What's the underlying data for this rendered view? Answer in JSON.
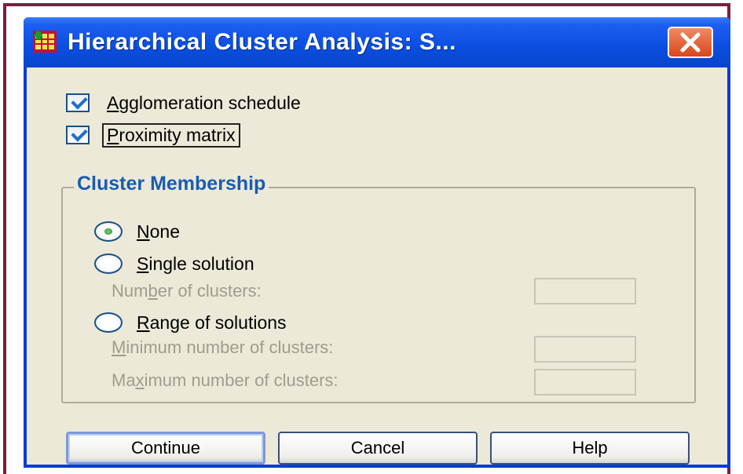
{
  "window": {
    "title": "Hierarchical Cluster Analysis: S...",
    "close_icon": "close-icon",
    "app_icon": "spss-table-icon"
  },
  "statistics": {
    "agglomeration": {
      "label": "Agglomeration schedule",
      "mnemonic": "A",
      "rest": "gglomeration schedule",
      "checked": true
    },
    "proximity": {
      "label": "Proximity matrix",
      "mnemonic": "P",
      "rest": "roximity matrix",
      "checked": true
    }
  },
  "cluster_membership": {
    "title": "Cluster Membership",
    "none": {
      "mnemonic": "N",
      "rest": "one",
      "selected": true
    },
    "single": {
      "mnemonic": "S",
      "rest": "ingle solution",
      "selected": false
    },
    "number_of_clusters": {
      "pre": "Num",
      "mnemonic": "b",
      "post": "er of clusters:",
      "value": ""
    },
    "range": {
      "mnemonic": "R",
      "rest": "ange of solutions",
      "selected": false
    },
    "minimum": {
      "mnemonic": "M",
      "rest": "inimum number of clusters:",
      "value": ""
    },
    "maximum": {
      "pre": "Ma",
      "mnemonic": "x",
      "post": "imum number of clusters:",
      "value": ""
    }
  },
  "buttons": {
    "continue": "Continue",
    "cancel": "Cancel",
    "help": "Help"
  },
  "colors": {
    "titlebar": "#0a4ee0",
    "frame": "#7a1f3d",
    "dialog_bg": "#ece9d8",
    "group_title": "#1a5cb0"
  }
}
